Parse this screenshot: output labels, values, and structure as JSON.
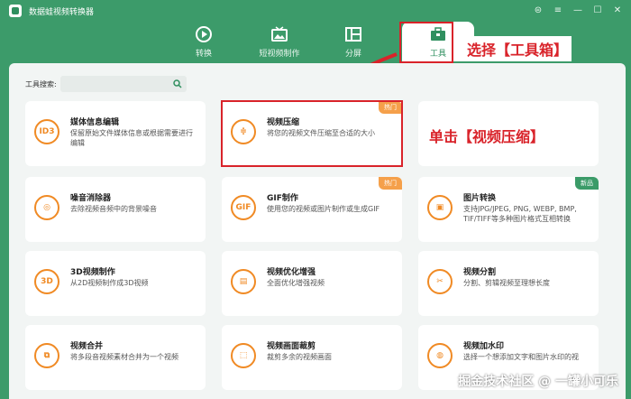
{
  "app": {
    "title": "数据蛙视频转换器"
  },
  "window_controls": [
    "⊜",
    "≡",
    "—",
    "☐",
    "✕"
  ],
  "tabs": [
    {
      "label": "转换",
      "icon": "convert-icon"
    },
    {
      "label": "短视频制作",
      "icon": "tv-icon"
    },
    {
      "label": "分屏",
      "icon": "split-screen-icon"
    },
    {
      "label": "工具",
      "icon": "toolbox-icon",
      "active": true
    }
  ],
  "annotations": {
    "select_toolbox": "选择【工具箱】",
    "click_compress": "单击【视频压缩】"
  },
  "search": {
    "label": "工具搜索:",
    "placeholder": ""
  },
  "cards": [
    {
      "title": "媒体信息编辑",
      "desc": "保留原始文件媒体信息或根据需要进行编辑",
      "icon_text": "ID3"
    },
    {
      "title": "视频压缩",
      "desc": "将您的视频文件压缩至合适的大小",
      "icon_text": "≑",
      "badge": "热门"
    },
    {
      "title": "",
      "desc": "",
      "icon_text": ""
    },
    {
      "title": "噪音消除器",
      "desc": "去除视频音频中的背景噪音",
      "icon_text": "◎"
    },
    {
      "title": "GIF制作",
      "desc": "使用您的视频或图片制作或生成GIF",
      "icon_text": "GIF",
      "badge": "热门"
    },
    {
      "title": "图片转换",
      "desc": "支持JPG/JPEG, PNG, WEBP, BMP, TIF/TIFF等多种图片格式互相转换",
      "icon_text": "▣",
      "badge": "新品"
    },
    {
      "title": "3D视频制作",
      "desc": "从2D视频制作成3D视频",
      "icon_text": "3D"
    },
    {
      "title": "视频优化增强",
      "desc": "全面优化增强视频",
      "icon_text": "▤"
    },
    {
      "title": "视频分割",
      "desc": "分割、剪辑视频至理想长度",
      "icon_text": "✂"
    },
    {
      "title": "视频合并",
      "desc": "将多段音视频素材合并为一个视频",
      "icon_text": "⧉"
    },
    {
      "title": "视频画面裁剪",
      "desc": "裁剪多余的视频画面",
      "icon_text": "⬚"
    },
    {
      "title": "视频加水印",
      "desc": "选择一个想添加文字和图片水印的视",
      "icon_text": "◍"
    }
  ],
  "watermark": "掘金技术社区 @ 一罐小可乐",
  "colors": {
    "brand_green": "#3c9b6a",
    "accent_orange": "#f08a24",
    "annotation_red": "#d9232a"
  }
}
